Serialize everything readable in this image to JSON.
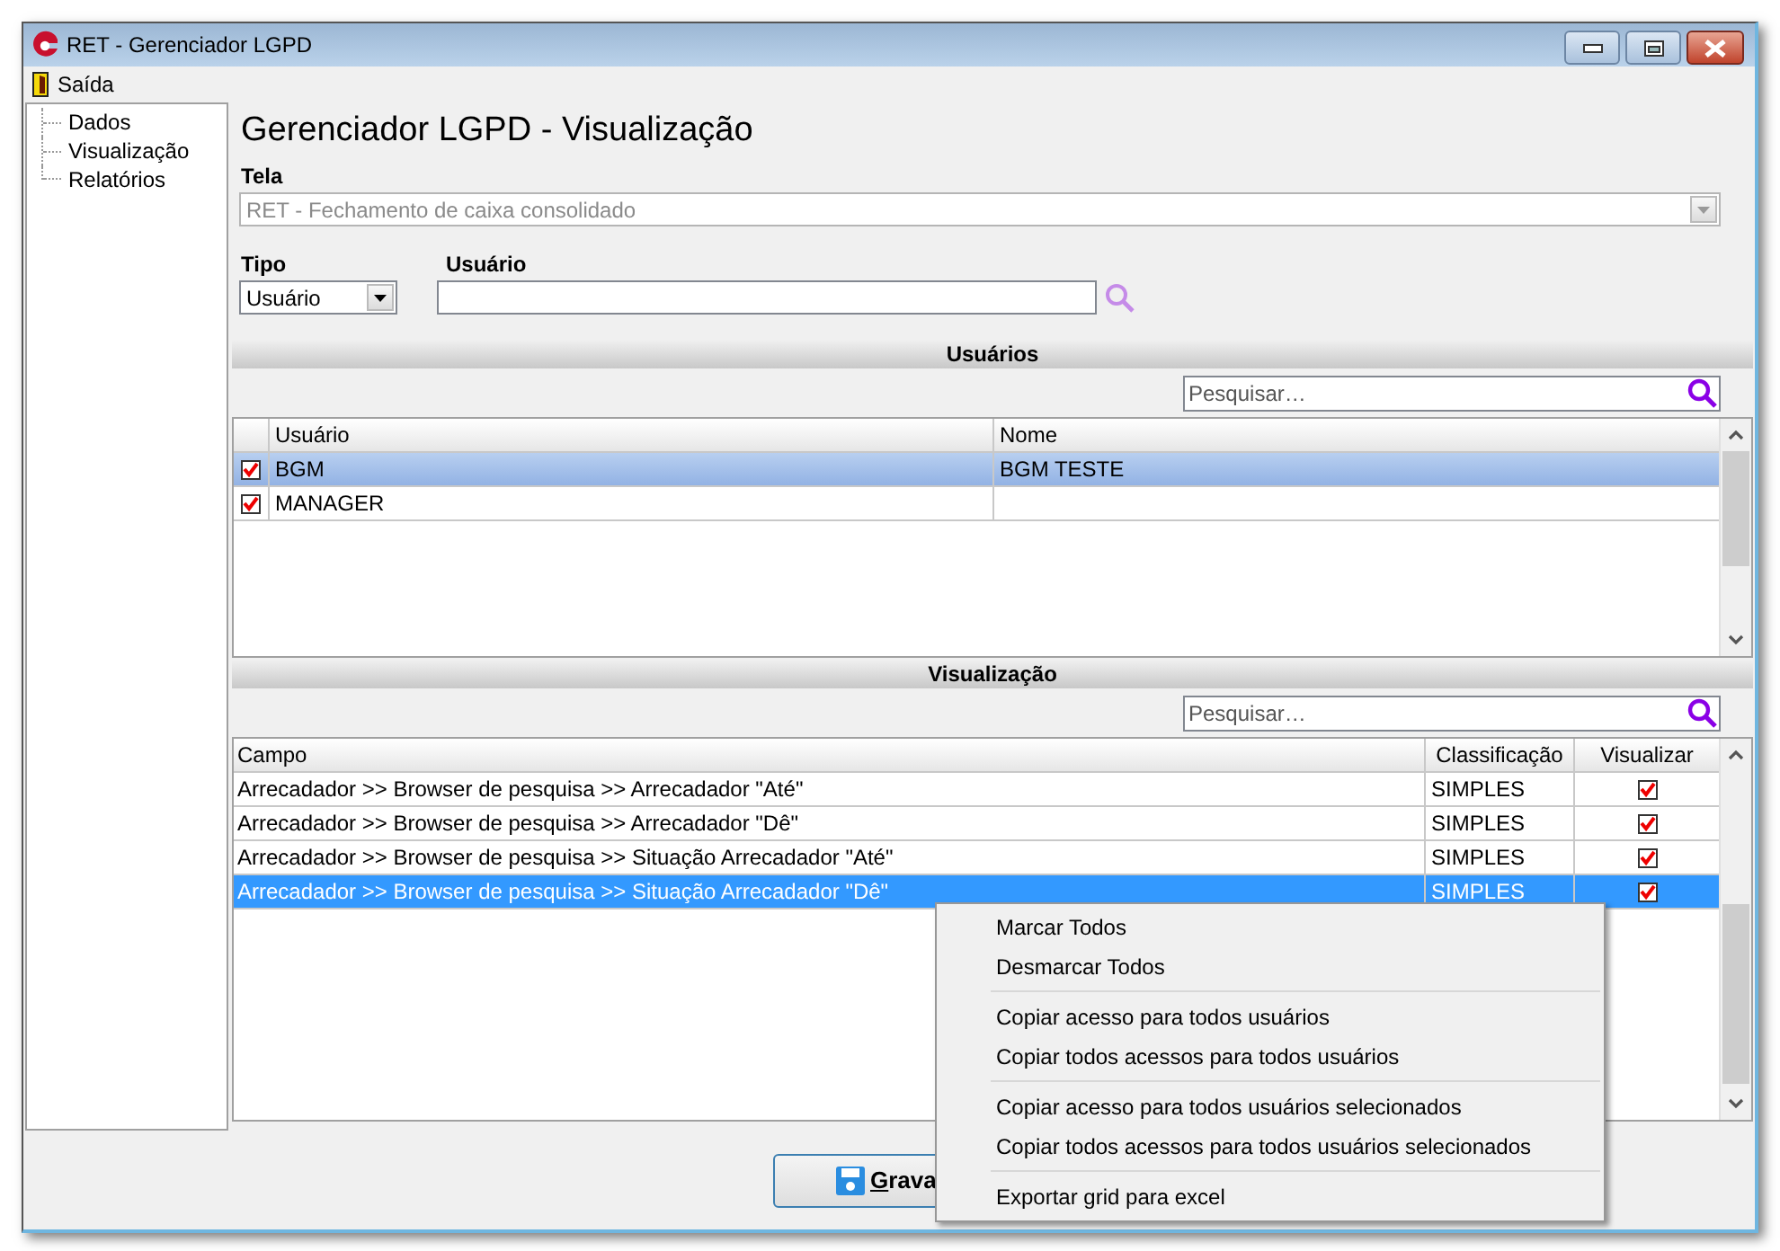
{
  "window": {
    "title": "RET - Gerenciador LGPD"
  },
  "menu_bar": [
    "Saída"
  ],
  "sidebar": {
    "items": [
      "Dados",
      "Visualização",
      "Relatórios"
    ]
  },
  "page_title": "Gerenciador LGPD - Visualização",
  "tela": {
    "label": "Tela",
    "value": "RET - Fechamento de caixa consolidado",
    "disabled": true
  },
  "tipo": {
    "label": "Tipo",
    "value": "Usuário"
  },
  "usuario": {
    "label": "Usuário"
  },
  "users_section": {
    "title": "Usuários",
    "search": {
      "placeholder": "Pesquisar…"
    },
    "columns": [
      "Usuário",
      "Nome"
    ],
    "rows": [
      {
        "usuario": "BGM",
        "nome": "BGM TESTE",
        "checked": true,
        "selected": true
      },
      {
        "usuario": "MANAGER",
        "checked": true,
        "selected": false
      }
    ]
  },
  "view_section": {
    "title": "Visualização",
    "search": {
      "placeholder": "Pesquisar…"
    },
    "columns": [
      "Campo",
      "Classificação",
      "Visualizar"
    ],
    "rows": [
      {
        "campo": "Arrecadador >> Browser de pesquisa >> Arrecadador \"Até\"",
        "classificacao": "SIMPLES",
        "visualizar": true,
        "selected": false
      },
      {
        "campo": "Arrecadador >> Browser de pesquisa >> Arrecadador \"Dê\"",
        "classificacao": "SIMPLES",
        "visualizar": true,
        "selected": false
      },
      {
        "campo": "Arrecadador >> Browser de pesquisa >> Situação Arrecadador \"Até\"",
        "classificacao": "SIMPLES",
        "visualizar": true,
        "selected": false
      },
      {
        "campo": "Arrecadador >> Browser de pesquisa >> Situação Arrecadador \"Dê\"",
        "classificacao": "SIMPLES",
        "visualizar": true,
        "selected": true
      }
    ]
  },
  "save_button": {
    "label": "Grava"
  },
  "context_menu": {
    "groups": [
      [
        "Marcar Todos",
        "Desmarcar Todos"
      ],
      [
        "Copiar acesso para todos usuários",
        "Copiar todos acessos para todos usuários"
      ],
      [
        "Copiar acesso para todos usuários selecionados",
        "Copiar todos acessos para todos usuários selecionados"
      ],
      [
        "Exportar grid para excel"
      ]
    ]
  }
}
